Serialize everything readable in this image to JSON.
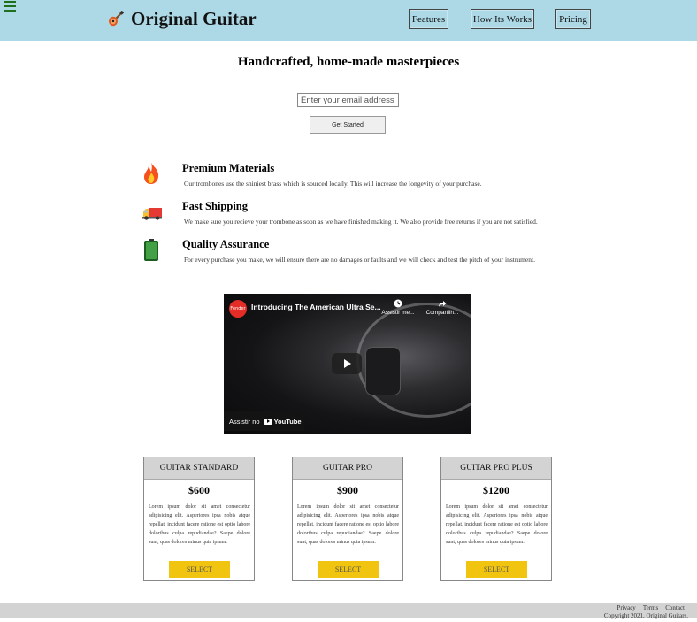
{
  "header": {
    "brand": "Original Guitar",
    "nav": {
      "features": "Features",
      "how": "How Its Works",
      "pricing": "Pricing"
    },
    "colors": {
      "background": "#add8e6"
    }
  },
  "hero": {
    "title": "Handcrafted, home-made masterpieces",
    "email_placeholder": "Enter your email address",
    "cta": "Get Started"
  },
  "features": [
    {
      "icon": "fire-icon",
      "title": "Premium Materials",
      "description": "Our trombones use the shiniest brass which is sourced locally. This will increase the longevity of your purchase."
    },
    {
      "icon": "delivery-truck-icon",
      "title": "Fast Shipping",
      "description": "We make sure you recieve your trombone as soon as we have finished making it. We also provide free returns if you are not satisfied."
    },
    {
      "icon": "battery-icon",
      "title": "Quality Assurance",
      "description": "For every purchase you make, we will ensure there are no damages or faults and we will check and test the pitch of your instrument."
    }
  ],
  "video": {
    "title": "Introducing The American Ultra Se...",
    "channel": "Fender",
    "watch_later": "Assistir me...",
    "share": "Compartilh...",
    "watch_on": "Assistir no",
    "platform": "YouTube"
  },
  "pricing": [
    {
      "name": "GUITAR STANDARD",
      "price": "$600",
      "description": "Lorem ipsum dolor sit amet consectetur adipisicing elit. Asperiores ipsa nobis atque repellat, incidunt facere ratione est optio labore doloribus culpa repudiandae? Saepe dolore sunt, quas dolores minus quia ipsum.",
      "button": "SELECT"
    },
    {
      "name": "GUITAR PRO",
      "price": "$900",
      "description": "Lorem ipsum dolor sit amet consectetur adipisicing elit. Asperiores ipsa nobis atque repellat, incidunt facere ratione est optio labore doloribus culpa repudiandae? Saepe dolore sunt, quas dolores minus quia ipsum.",
      "button": "SELECT"
    },
    {
      "name": "GUITAR PRO PLUS",
      "price": "$1200",
      "description": "Lorem ipsum dolor sit amet consectetur adipisicing elit. Asperiores ipsa nobis atque repellat, incidunt facere ratione est optio labore doloribus culpa repudiandae? Saepe dolore sunt, quas dolores minus quia ipsum.",
      "button": "SELECT"
    }
  ],
  "footer": {
    "links": [
      "Privacy",
      "Terms",
      "Contact"
    ],
    "copyright": "Copyright 2021, Original Guitars."
  }
}
